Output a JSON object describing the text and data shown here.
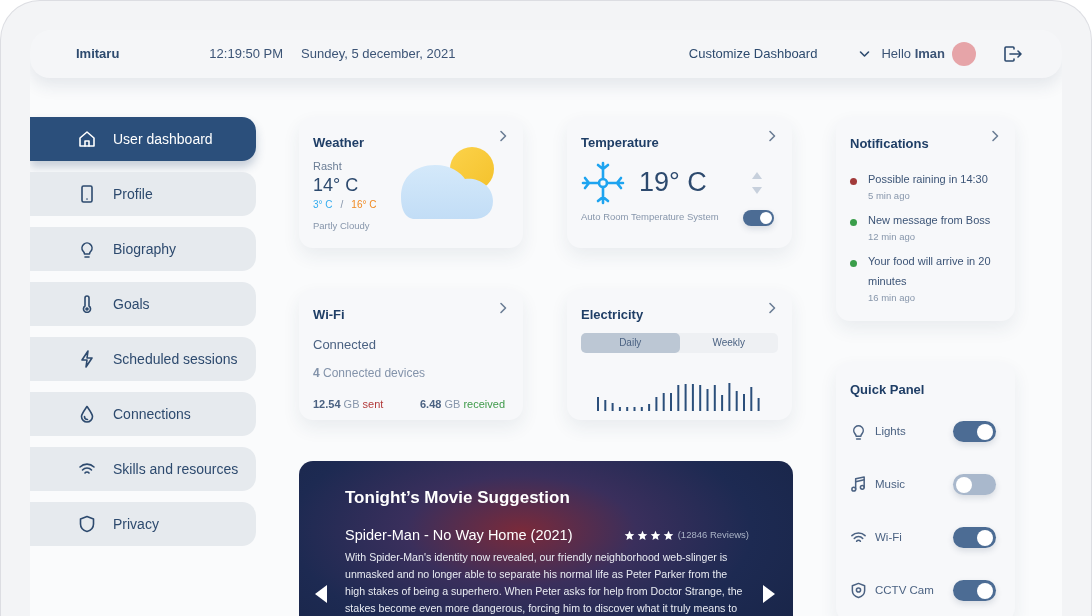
{
  "header": {
    "brand": "Imitaru",
    "time": "12:19:50 PM",
    "date": "Sundey, 5 december, 2021",
    "customize": "Customize Dashboard",
    "greeting": "Hello **Iman**"
  },
  "sidebar": {
    "items": [
      {
        "label": "User dashboard",
        "selected": true
      },
      {
        "label": "Profile",
        "selected": false
      },
      {
        "label": "Biography",
        "selected": false
      },
      {
        "label": "Goals",
        "selected": false
      },
      {
        "label": "Scheduled sessions",
        "selected": false
      },
      {
        "label": "Connections",
        "selected": false
      },
      {
        "label": "Skills and resources",
        "selected": false
      },
      {
        "label": "Privacy",
        "selected": false
      }
    ]
  },
  "weather": {
    "title": "Weather",
    "city": "Rasht",
    "temperature": "14° C",
    "low": "3° C",
    "separator": "/",
    "high": "16° C",
    "condition": "Partly Cloudy"
  },
  "temperature": {
    "title": "Temperature",
    "value": "19° C",
    "caption": "Auto Room Temperature System",
    "auto_on": true
  },
  "wifi": {
    "title": "Wi-Fi",
    "status": "Connected",
    "devices": "**4** Connected devices",
    "sent": {
      "amount": "12.54",
      "unit": "GB",
      "label": "sent"
    },
    "received": {
      "amount": "6.48",
      "unit": "GB",
      "label": "received"
    }
  },
  "electricity": {
    "title": "Electricity",
    "tabs": [
      {
        "label": "Daily",
        "selected": true
      },
      {
        "label": "Weekly",
        "selected": false
      }
    ]
  },
  "movie": {
    "heading": "Tonight’s Movie Suggestion",
    "title": "Spider-Man - No Way Home (2021)",
    "stars": 4,
    "reviews": "(12846 Reviews)",
    "synopsis": "With Spider-Man's identity now revealed, our friendly neighborhood web-slinger is unmasked and no longer able to separate his normal life as Peter Parker from the high stakes of being a superhero. When Peter asks for help from Doctor Strange, the stakes become even more dangerous, forcing him to discover what it truly means to"
  },
  "notifications": {
    "title": "Notifications",
    "items": [
      {
        "text": "Possible raining in 14:30",
        "time": "5 min ago",
        "color": "#a23a3a"
      },
      {
        "text": "New message from Boss",
        "time": "12 min ago",
        "color": "#3a9e4a"
      },
      {
        "text": "Your food will arrive in 20 minutes",
        "time": "16 min ago",
        "color": "#3a9e4a"
      }
    ]
  },
  "quick_panel": {
    "title": "Quick Panel",
    "items": [
      {
        "label": "Lights",
        "on": true
      },
      {
        "label": "Music",
        "on": false
      },
      {
        "label": "Wi-Fi",
        "on": true
      },
      {
        "label": "CCTV Cam",
        "on": true
      }
    ]
  }
}
